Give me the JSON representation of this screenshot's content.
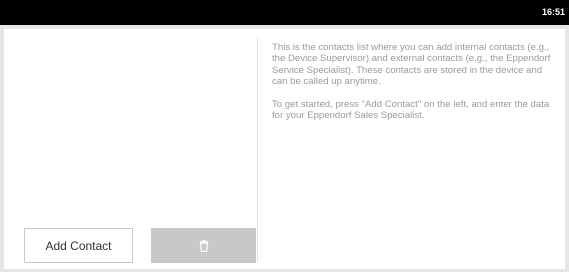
{
  "status_bar": {
    "time": "16:51"
  },
  "info": {
    "paragraph1": "This is the contacts list where you can add internal contacts (e.g., the Device Supervisor) and external contacts (e.g., the Eppendorf Service Specialist). These contacts are stored in the device and can be called up anytime.",
    "paragraph2": "To get started, press \"Add Contact\" on the left, and enter the data for your Eppendorf Sales Specialist."
  },
  "actions": {
    "add_contact_label": "Add Contact",
    "delete_icon": "trash-icon"
  }
}
